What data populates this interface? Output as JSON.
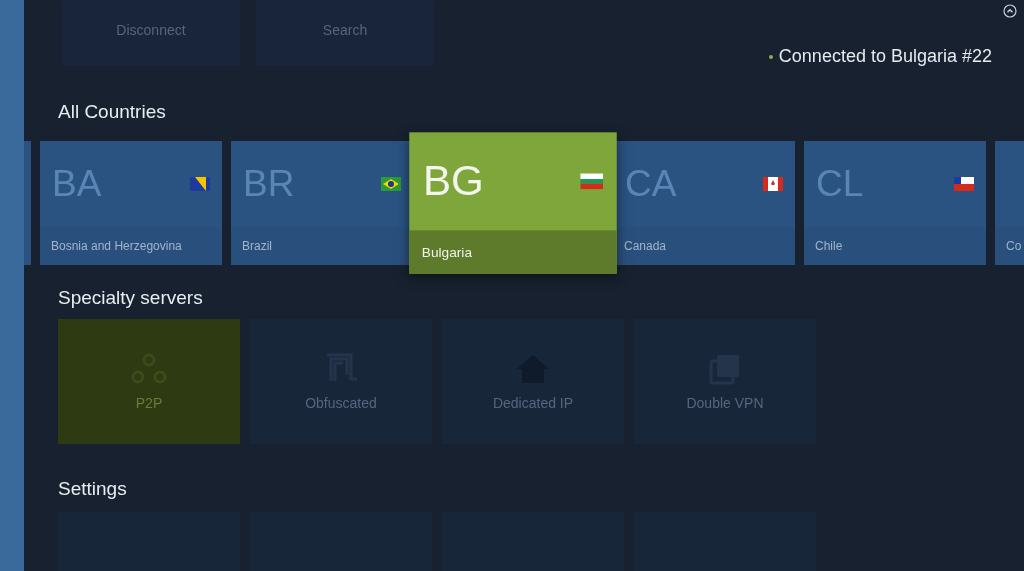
{
  "top_actions": [
    {
      "label": "Disconnect"
    },
    {
      "label": "Search"
    }
  ],
  "status": {
    "text": "Connected to Bulgaria #22",
    "connected": true
  },
  "countries": {
    "title": "All Countries",
    "items": [
      {
        "code": "BA",
        "name": "Bosnia and Herzegovina",
        "kind": "ba",
        "selected": false
      },
      {
        "code": "BR",
        "name": "Brazil",
        "kind": "br",
        "selected": false
      },
      {
        "code": "BG",
        "name": "Bulgaria",
        "kind": "bg",
        "selected": true
      },
      {
        "code": "CA",
        "name": "Canada",
        "kind": "ca",
        "selected": false
      },
      {
        "code": "CL",
        "name": "Chile",
        "kind": "cl",
        "selected": false
      },
      {
        "name": "Co",
        "kind": "partial",
        "selected": false
      }
    ]
  },
  "specialty": {
    "title": "Specialty servers",
    "items": [
      {
        "label": "P2P",
        "kind": "p2p",
        "selected": true
      },
      {
        "label": "Obfuscated",
        "kind": "obfuscated",
        "selected": false
      },
      {
        "label": "Dedicated IP",
        "kind": "dedicated",
        "selected": false
      },
      {
        "label": "Double VPN",
        "kind": "double",
        "selected": false
      }
    ]
  },
  "settings": {
    "title": "Settings"
  }
}
